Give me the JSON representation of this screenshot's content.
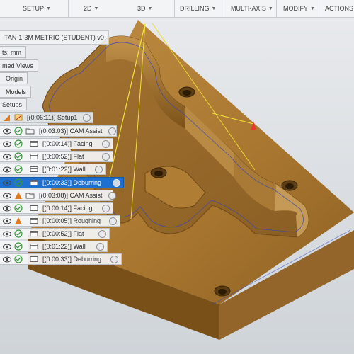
{
  "toolbar": {
    "setup_label": "SETUP",
    "mode_2d_label": "2D",
    "mode_3d_label": "3D",
    "drilling_label": "DRILLING",
    "multi_axis_label": "MULTI-AXIS",
    "modify_label": "MODIFY",
    "actions_label": "ACTIONS"
  },
  "browser": {
    "document_title": "TAN-1-3M METRIC (STUDENT) v0",
    "units_label": "ts: mm",
    "named_views_label": "med Views",
    "origin_label": "Origin",
    "models_label": "Models",
    "setups_label": "Setups",
    "setup": {
      "label": "[(0:06:11)] Setup1"
    },
    "operations": [
      {
        "label": "[(0:03:03)] CAM Assist",
        "type": "folder-group",
        "level": 0,
        "selected": false
      },
      {
        "label": "[(0:00:14)] Facing",
        "type": "operation",
        "level": 1,
        "selected": false
      },
      {
        "label": "[(0:00:52)] Flat",
        "type": "operation",
        "level": 1,
        "selected": false
      },
      {
        "label": "[(0:01:22)] Wall",
        "type": "operation",
        "level": 1,
        "selected": false
      },
      {
        "label": "[(0:00:33)] Deburring",
        "type": "operation",
        "level": 1,
        "selected": true
      },
      {
        "label": "[(0:03:08)] CAM Assist",
        "type": "folder-group",
        "level": 0,
        "selected": false
      },
      {
        "label": "[(0:00:14)] Facing",
        "type": "operation",
        "level": 1,
        "selected": false
      },
      {
        "label": "[(0:00:05)] Roughing",
        "type": "operation",
        "level": 1,
        "selected": false
      },
      {
        "label": "[(0:00:52)] Flat",
        "type": "operation",
        "level": 1,
        "selected": false
      },
      {
        "label": "[(0:01:22)] Wall",
        "type": "operation",
        "level": 1,
        "selected": false
      },
      {
        "label": "[(0:00:33)] Deburring",
        "type": "operation",
        "level": 1,
        "selected": false
      }
    ]
  },
  "colors": {
    "stock_top": "#b07d35",
    "stock_side": "#8a5c22",
    "selection_blue": "#1d6fd0",
    "check_green": "#3a9a3e",
    "toolpath_yellow": "#f2e23a"
  }
}
